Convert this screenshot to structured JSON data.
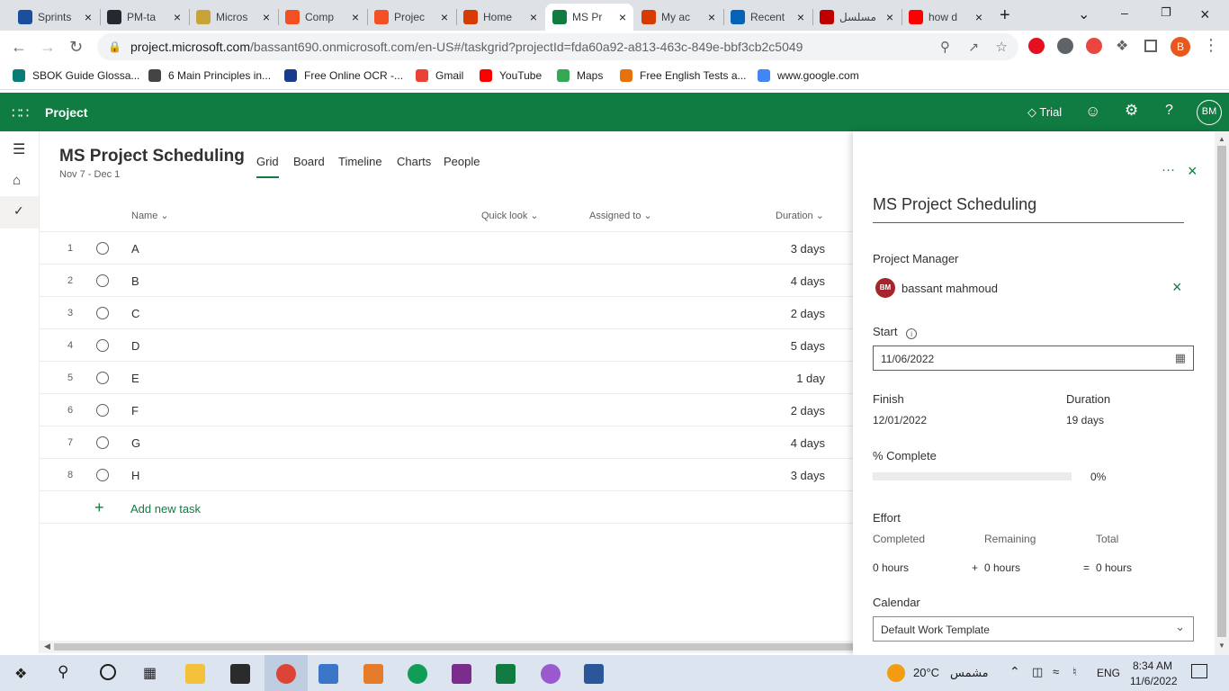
{
  "browser": {
    "tabs": [
      {
        "label": "Sprints",
        "color": "#1a4fa0"
      },
      {
        "label": "PM-ta",
        "color": "#24292f"
      },
      {
        "label": "Micros",
        "color": "#c7a33a"
      },
      {
        "label": "Comp",
        "color": "#f25022"
      },
      {
        "label": "Projec",
        "color": "#f25022"
      },
      {
        "label": "Home",
        "color": "#d83b01"
      },
      {
        "label": "MS Pr",
        "color": "#107c41"
      },
      {
        "label": "My ac",
        "color": "#d83b01"
      },
      {
        "label": "Recent",
        "color": "#0364b8"
      },
      {
        "label": "مسلسل",
        "color": "#c00000"
      },
      {
        "label": "how d",
        "color": "#ff0000"
      }
    ],
    "url_host": "project.microsoft.com",
    "url_path": "/bassant690.onmicrosoft.com/en-US#/taskgrid?projectId=fda60a92-a813-463c-849e-bbf3cb2c5049",
    "profile_initial": "B",
    "bookmarks": [
      {
        "label": "SBOK Guide Glossa...",
        "color": "#0a7c76"
      },
      {
        "label": "6 Main Principles in...",
        "color": "#444"
      },
      {
        "label": "Free Online OCR -...",
        "color": "#1a3b8c"
      },
      {
        "label": "Gmail",
        "color": "#ea4335"
      },
      {
        "label": "YouTube",
        "color": "#ff0000"
      },
      {
        "label": "Maps",
        "color": "#34a853"
      },
      {
        "label": "Free English Tests a...",
        "color": "#e8710a"
      },
      {
        "label": "www.google.com",
        "color": "#4285f4"
      }
    ]
  },
  "app": {
    "name": "Project",
    "trial_label": "Trial",
    "user_initials": "BM",
    "brand_color": "#107c41"
  },
  "project": {
    "title": "MS Project Scheduling",
    "date_range": "Nov 7 - Dec 1",
    "views": [
      "Grid",
      "Board",
      "Timeline",
      "Charts",
      "People"
    ],
    "active_view": "Grid"
  },
  "grid": {
    "columns": {
      "name": "Name",
      "quick_look": "Quick look",
      "assigned_to": "Assigned to",
      "duration": "Duration"
    },
    "rows": [
      {
        "num": "1",
        "name": "A",
        "duration": "3 days"
      },
      {
        "num": "2",
        "name": "B",
        "duration": "4 days"
      },
      {
        "num": "3",
        "name": "C",
        "duration": "2 days"
      },
      {
        "num": "4",
        "name": "D",
        "duration": "5 days"
      },
      {
        "num": "5",
        "name": "E",
        "duration": "1 day"
      },
      {
        "num": "6",
        "name": "F",
        "duration": "2 days"
      },
      {
        "num": "7",
        "name": "G",
        "duration": "4 days"
      },
      {
        "num": "8",
        "name": "H",
        "duration": "3 days"
      }
    ],
    "add_task_label": "Add new task"
  },
  "panel": {
    "title": "MS Project Scheduling",
    "pm_label": "Project Manager",
    "pm_initials": "BM",
    "pm_name": "bassant mahmoud",
    "start_label": "Start",
    "start_value": "11/06/2022",
    "finish_label": "Finish",
    "finish_value": "12/01/2022",
    "duration_label": "Duration",
    "duration_value": "19 days",
    "complete_label": "% Complete",
    "complete_value": "0%",
    "complete_fraction": 0,
    "effort_label": "Effort",
    "completed_label": "Completed",
    "remaining_label": "Remaining",
    "total_label": "Total",
    "completed_value": "0 hours",
    "remaining_value": "0 hours",
    "total_value": "0 hours",
    "plus": "+",
    "equals": "=",
    "calendar_label": "Calendar",
    "calendar_value": "Default Work Template"
  },
  "taskbar": {
    "temperature": "20°C",
    "weather_text": "مشمس",
    "lang": "ENG",
    "time": "8:34 AM",
    "date": "11/6/2022"
  }
}
